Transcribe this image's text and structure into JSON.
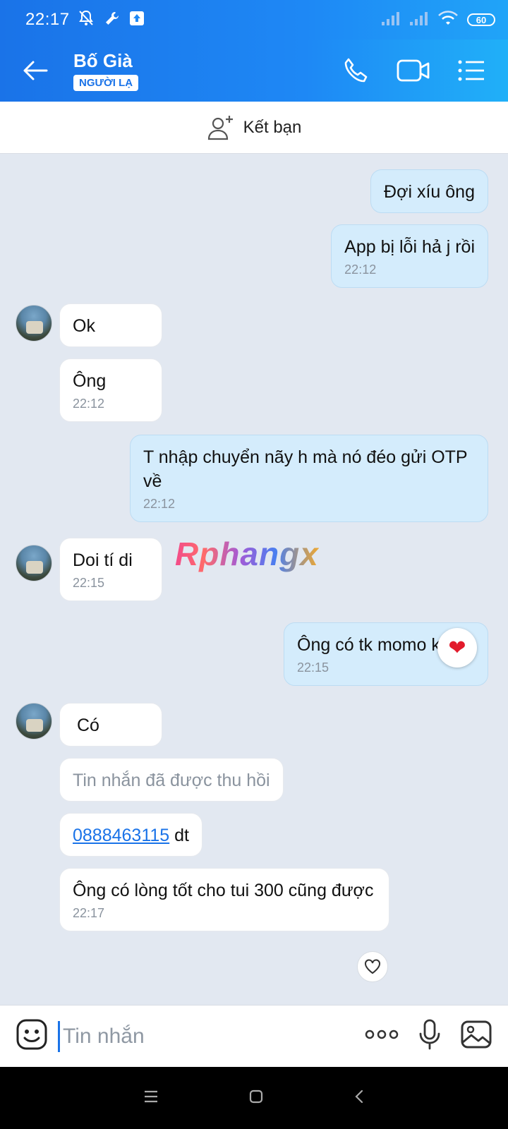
{
  "status_bar": {
    "time": "22:17",
    "battery": "60"
  },
  "header": {
    "contact_name": "Bố Già",
    "badge": "NGƯỜI LẠ"
  },
  "friend_bar": {
    "label": "Kết bạn"
  },
  "messages": [
    {
      "dir": "out",
      "text": "Đợi xíu ông",
      "time": ""
    },
    {
      "dir": "out",
      "text": "App bị lỗi hả j rồi",
      "time": "22:12"
    },
    {
      "dir": "in",
      "text": "Ok",
      "time": ""
    },
    {
      "dir": "in",
      "text": "Ông",
      "time": "22:12"
    },
    {
      "dir": "out",
      "text": "T nhập chuyển nãy h mà nó đéo gửi OTP về",
      "time": "22:12"
    },
    {
      "dir": "in",
      "text": "Doi tí di",
      "time": "22:15"
    },
    {
      "dir": "out",
      "text": "Ông có tk momo kk",
      "time": "22:15"
    },
    {
      "dir": "in",
      "text": "Có",
      "time": ""
    },
    {
      "dir": "in",
      "text": "Tin nhắn đã được thu hồi",
      "time": ""
    },
    {
      "dir": "in",
      "text": "0888463115",
      "text2": " dt",
      "time": ""
    },
    {
      "dir": "in",
      "text": "Ông có lòng tốt cho tui 300 cũng được",
      "time": "22:17"
    }
  ],
  "watermark": "Rphangx",
  "input": {
    "placeholder": "Tin nhắn"
  },
  "colors": {
    "accent": "#1a73e8",
    "outgoing_bubble": "#d4ecfc",
    "background": "#e2e8f1"
  }
}
